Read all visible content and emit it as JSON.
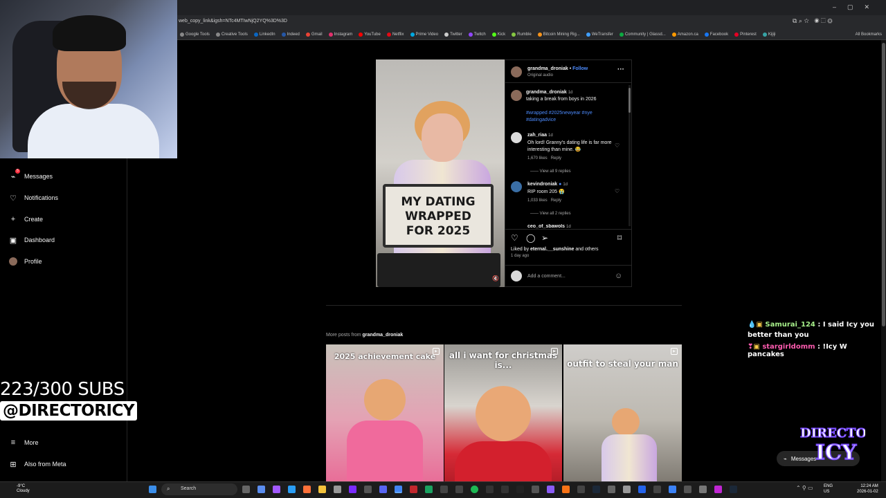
{
  "browser": {
    "url": "web_copy_link&igsh=NTc4MTIwNjQ2YQ%3D%3D",
    "bookmarks": [
      "Google Tools",
      "Creative Tools",
      "LinkedIn",
      "Indeed",
      "Gmail",
      "Instagram",
      "YouTube",
      "Netflix",
      "Prime Video",
      "Twitter",
      "Twitch",
      "Kick",
      "Rumble",
      "Bitcoin Mining Rig...",
      "WeTransfer",
      "Community | Glassd...",
      "Amazon.ca",
      "Facebook",
      "Pinterest",
      "Kijiji"
    ],
    "all_bookmarks": "All Bookmarks",
    "bookmark_colors": [
      "#888888",
      "#888888",
      "#0a66c2",
      "#2557a7",
      "#ea4335",
      "#e1306c",
      "#ff0000",
      "#e50914",
      "#00a8e1",
      "#cccccc",
      "#9146ff",
      "#53fc18",
      "#85c742",
      "#f7931a",
      "#409fff",
      "#0caa41",
      "#ff9900",
      "#1877f2",
      "#e60023",
      "#37a3a5"
    ]
  },
  "sidebar": {
    "items": [
      {
        "label": "Messages",
        "icon": "messenger-icon",
        "badge": "5"
      },
      {
        "label": "Notifications",
        "icon": "heart-icon"
      },
      {
        "label": "Create",
        "icon": "plus-icon"
      },
      {
        "label": "Dashboard",
        "icon": "dashboard-icon"
      },
      {
        "label": "Profile",
        "icon": "avatar-icon"
      }
    ],
    "more": "More",
    "also_from_meta": "Also from Meta"
  },
  "stream_overlay": {
    "subs": "223/300 SUBS",
    "handle": "@DIRECTORICY",
    "chat": [
      {
        "user": "Samurai_124",
        "message": " : I said Icy you better than you",
        "color": "#a7f08a"
      },
      {
        "user": "stargirldomm",
        "message": " : !Icy W pancakes",
        "color": "#ff5cb0"
      }
    ],
    "logo_text": "DIRECTOR ICY"
  },
  "post": {
    "laptop_lines": [
      "MY DATING",
      "WRAPPED",
      "FOR 2025"
    ],
    "author": "grandma_droniak",
    "follow": "Follow",
    "audio": "Original audio",
    "caption_time": "1d",
    "caption": "taking a break from boys in 2026",
    "hashtags": "#wrapped #2025newyear #nye #datingadvice",
    "comments": [
      {
        "user": "zah_riaa",
        "time": "1d",
        "text": "Oh lord! Granny's dating life is far more interesting than mine. 😂",
        "likes": "1,670 likes",
        "reply": "Reply",
        "view_replies": "View all 9 replies"
      },
      {
        "user": "kevindroniak",
        "time": "1d",
        "text": "RIP room 205 😭",
        "likes": "1,033 likes",
        "reply": "Reply",
        "view_replies": "View all 2 replies"
      },
      {
        "user": "ceo_of_sbawols",
        "time": "1d"
      }
    ],
    "liked_by_prefix": "Liked by ",
    "liked_by_user": "eternal.__sunshine",
    "liked_by_suffix": " and others",
    "posted": "1 day ago",
    "add_comment": "Add a comment..."
  },
  "more_posts": {
    "label_prefix": "More posts from ",
    "user": "grandma_droniak",
    "items": [
      {
        "caption": "2025 achievement cake"
      },
      {
        "caption": "all i want for christmas is..."
      },
      {
        "caption": "outfit to steal your man"
      }
    ]
  },
  "floating_messages": "Messages",
  "taskbar": {
    "weather_temp": "-9°C",
    "weather_desc": "Cloudy",
    "search": "Search",
    "lang1": "ENG",
    "lang2": "US",
    "time": "12:24 AM",
    "date": "2026-01-02"
  }
}
